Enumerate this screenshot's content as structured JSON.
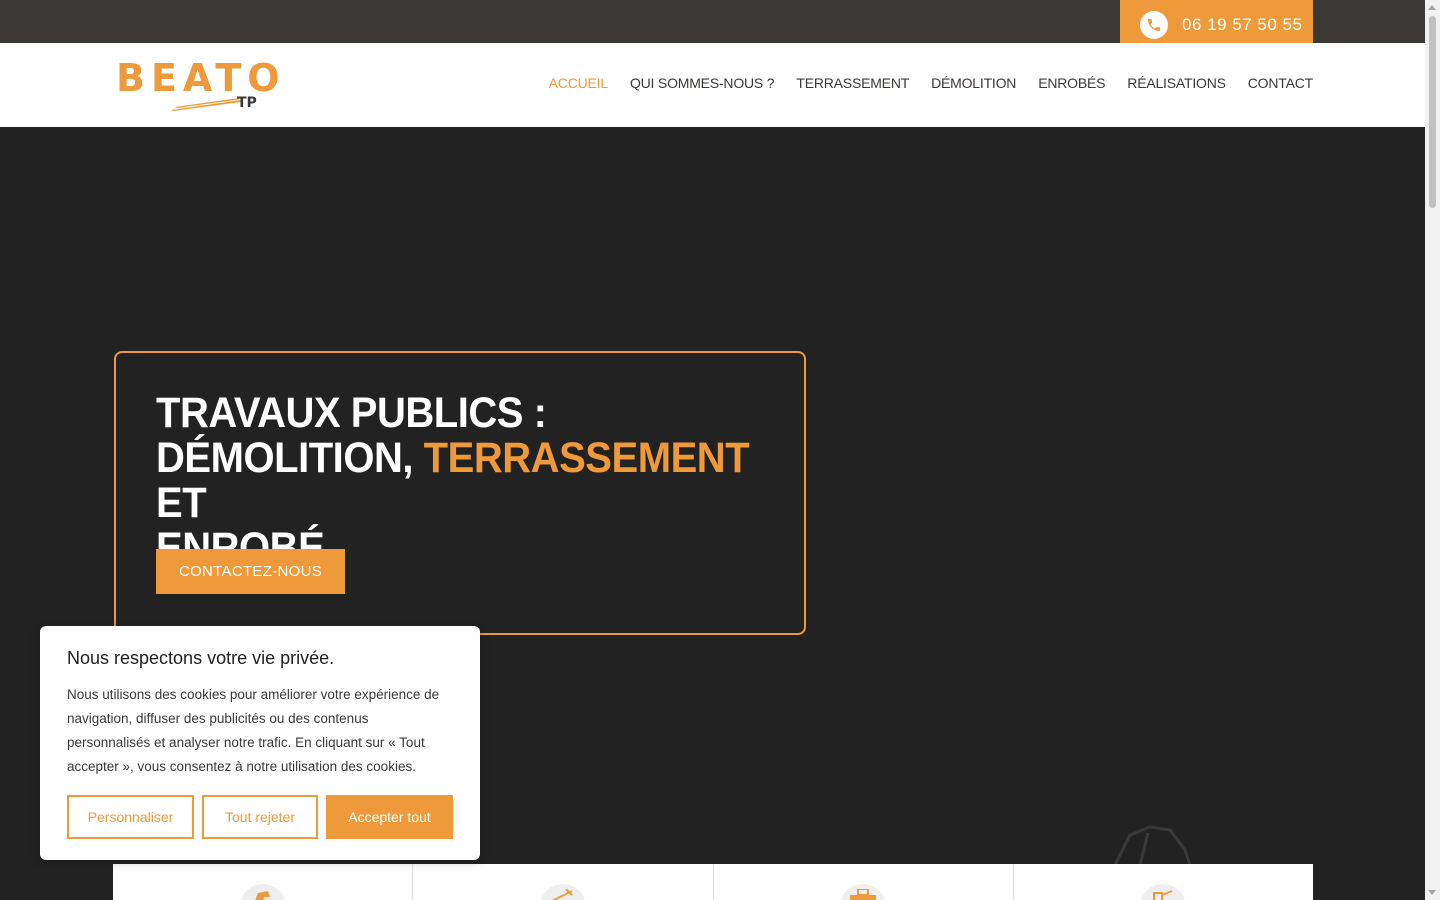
{
  "topbar": {
    "phone": "06 19 57 50 55"
  },
  "header": {
    "logo_word": "BEATO",
    "logo_sub": "TP",
    "nav": [
      {
        "label": "ACCUEIL",
        "active": true
      },
      {
        "label": "QUI SOMMES-NOUS ?"
      },
      {
        "label": "TERRASSEMENT"
      },
      {
        "label": "DÉMOLITION"
      },
      {
        "label": "ENROBÉS"
      },
      {
        "label": "RÉALISATIONS"
      },
      {
        "label": "CONTACT"
      }
    ]
  },
  "hero": {
    "title_line1": "TRAVAUX PUBLICS :",
    "title_part2": "DÉMOLITION, ",
    "title_highlight": "TERRASSEMENT",
    "title_part3": " ET",
    "title_line3": "ENROBÉ",
    "cta_label": "CONTACTEZ-NOUS"
  },
  "cookie": {
    "title": "Nous respectons votre vie privée.",
    "text": "Nous utilisons des cookies pour améliorer votre expérience de navigation, diffuser des publicités ou des contenus personnalisés et analyser notre trafic. En cliquant sur « Tout accepter », vous consentez à notre utilisation des cookies.",
    "customize": "Personnaliser",
    "reject": "Tout rejeter",
    "accept": "Accepter tout"
  },
  "cards": {
    "icons": [
      "excavator-icon",
      "demolition-icon",
      "roller-icon",
      "digger-icon"
    ]
  },
  "colors": {
    "accent": "#ee9a3a",
    "topbar": "#3c3836",
    "hero_bg": "#232222"
  }
}
